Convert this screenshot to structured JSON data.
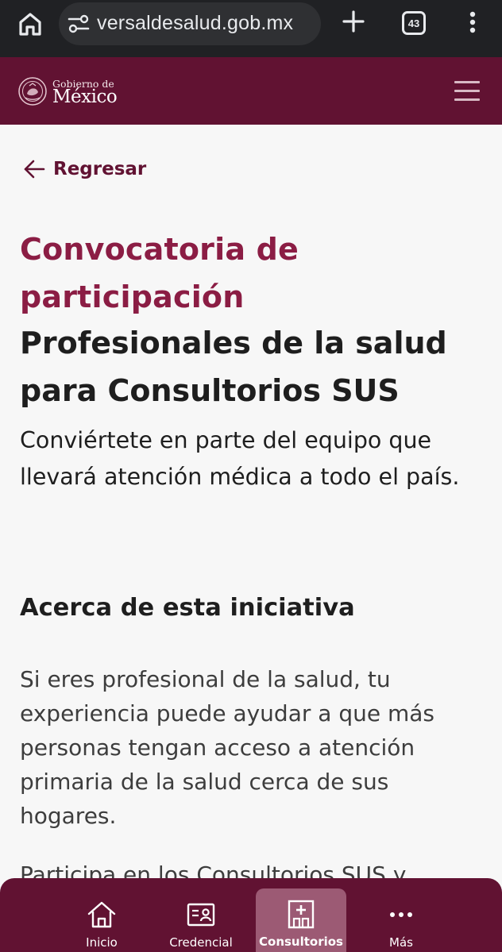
{
  "browser": {
    "url": "versaldesalud.gob.mx",
    "tab_count": "43"
  },
  "header": {
    "logo_small": "Gobierno de",
    "logo_big": "México"
  },
  "content": {
    "back_label": "Regresar",
    "title": "Convocatoria de participación",
    "subtitle": "Profesionales de la salud para Consultorios SUS",
    "lede": "Conviértete en parte del equipo que llevará atención médica a todo el país.",
    "section_heading": "Acerca de esta iniciativa",
    "paragraph": "Si eres profesional de la salud, tu experiencia puede ayudar a que más personas tengan acceso a atención primaria de la salud cerca de sus hogares.",
    "paragraph_cut": "Participa en los Consultorios SUS y"
  },
  "bottom_nav": {
    "items": [
      {
        "label": "Inicio",
        "icon": "home-icon"
      },
      {
        "label": "Credencial",
        "icon": "id-card-icon"
      },
      {
        "label": "Consultorios",
        "icon": "clinic-icon",
        "active": true
      },
      {
        "label": "Más",
        "icon": "more-icon"
      }
    ]
  },
  "colors": {
    "brand": "#611232",
    "title": "#8b1d44",
    "active_nav": "#9c5a74"
  }
}
